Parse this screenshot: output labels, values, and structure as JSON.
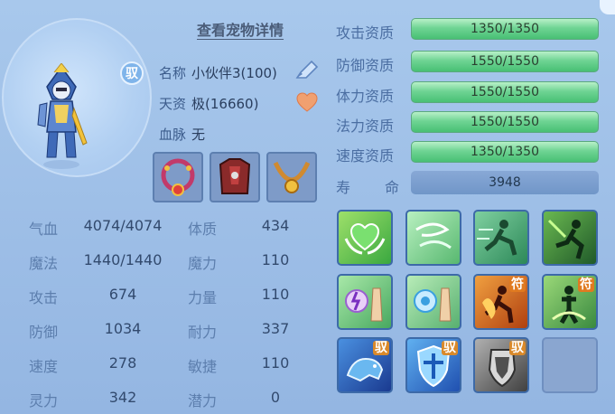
{
  "header": {
    "title": "查看宠物详情"
  },
  "badge": {
    "tame": "驭"
  },
  "info": [
    {
      "label": "名称",
      "value": "小伙伴3(100)"
    },
    {
      "label": "天资",
      "value": "极(16660)"
    },
    {
      "label": "血脉",
      "value": "无"
    }
  ],
  "icons": {
    "edit": "edit-pen-icon",
    "favorite": "heart-icon"
  },
  "stats": [
    {
      "l1": "气血",
      "v1": "4074/4074",
      "l2": "体质",
      "v2": "434"
    },
    {
      "l1": "魔法",
      "v1": "1440/1440",
      "l2": "魔力",
      "v2": "110"
    },
    {
      "l1": "攻击",
      "v1": "674",
      "l2": "力量",
      "v2": "110"
    },
    {
      "l1": "防御",
      "v1": "1034",
      "l2": "耐力",
      "v2": "337"
    },
    {
      "l1": "速度",
      "v1": "278",
      "l2": "敏捷",
      "v2": "110"
    },
    {
      "l1": "灵力",
      "v1": "342",
      "l2": "潜力",
      "v2": "0"
    }
  ],
  "aptitudes": [
    {
      "label": "攻击资质",
      "value": "1350/1350",
      "fill": 1.0
    },
    {
      "label": "防御资质",
      "value": "1550/1550",
      "fill": 1.0
    },
    {
      "label": "体力资质",
      "value": "1550/1550",
      "fill": 1.0
    },
    {
      "label": "法力资质",
      "value": "1550/1550",
      "fill": 1.0
    },
    {
      "label": "速度资质",
      "value": "1350/1350",
      "fill": 1.0
    }
  ],
  "life": {
    "label1": "寿",
    "label2": "命",
    "value": "3948"
  },
  "skill_tags": {
    "fu": "符",
    "yu": "驭"
  },
  "colors": {
    "apt_bar": "#48c074",
    "life_bar": "#7096c8",
    "bg": "#9cbde6"
  }
}
